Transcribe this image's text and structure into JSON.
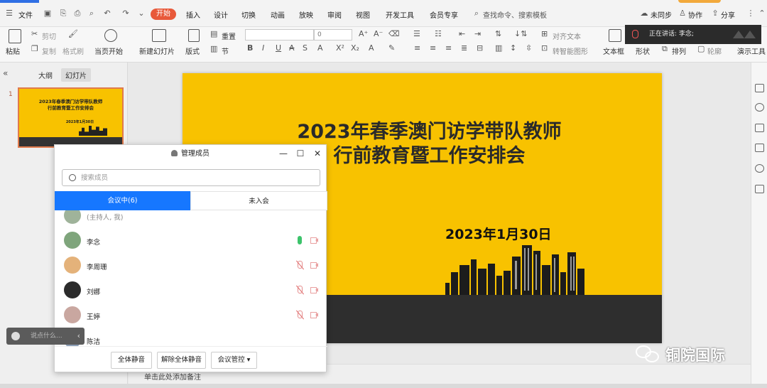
{
  "menu": {
    "file": "文件",
    "tabs": [
      "开始",
      "插入",
      "设计",
      "切换",
      "动画",
      "放映",
      "审阅",
      "视图",
      "开发工具",
      "会员专享"
    ],
    "search": "查找命令、搜索模板",
    "unsynced": "未同步",
    "collab": "协作",
    "share": "分享"
  },
  "ribbon": {
    "paste": "粘贴",
    "cut": "剪切",
    "copy": "复制",
    "format_painter": "格式刷",
    "from_current": "当页开始",
    "new_slide": "新建幻灯片",
    "layout": "版式",
    "section": "节",
    "reset": "重置",
    "font_size": "0",
    "align_text": "对齐文本",
    "smart_art": "转智能图形",
    "textbox": "文本框",
    "shape": "形状",
    "arrange": "排列",
    "outline": "轮廓",
    "present_tools": "演示工具"
  },
  "speaking": {
    "label": "正在讲话: 李念;"
  },
  "left_panel": {
    "tab_outline": "大纲",
    "tab_slides": "幻灯片",
    "slide_number": "1"
  },
  "slide": {
    "title_line1": "2023年春季澳门访学带队教师",
    "title_line2": "行前教育暨工作安排会",
    "date": "2023年1月30日"
  },
  "dialog": {
    "title": "管理成员",
    "search_placeholder": "搜索成员",
    "tab_in_meeting": "会议中(6)",
    "tab_not_joined": "未入会",
    "members": [
      {
        "name": "(主持人, 我)",
        "mic": "none",
        "avatar_color": "#9fb39a"
      },
      {
        "name": "李念",
        "mic": "on",
        "avatar_color": "#7fa57c"
      },
      {
        "name": "李周珊",
        "mic": "off",
        "avatar_color": "#e4b27a"
      },
      {
        "name": "刘娜",
        "mic": "off",
        "avatar_color": "#2b2b2b"
      },
      {
        "name": "王婷",
        "mic": "off",
        "avatar_color": "#c9a7a0"
      },
      {
        "name": "陈洁",
        "mic": "none",
        "avatar_color": "#8c9fb7"
      }
    ],
    "btn_mute_all": "全体静音",
    "btn_unmute_all": "解除全体静音",
    "btn_meeting_control": "会议管控"
  },
  "chat": {
    "placeholder": "说点什么..."
  },
  "status": {
    "notes_hint": "单击此处添加备注"
  },
  "watermark": {
    "text": "铜院国际"
  },
  "colors": {
    "slide_bg": "#f8c200",
    "slide_bar": "#2e2e2e",
    "accent_blue": "#1677ff",
    "start_tab": "#e8593a",
    "mic_on": "#3cc36b"
  }
}
